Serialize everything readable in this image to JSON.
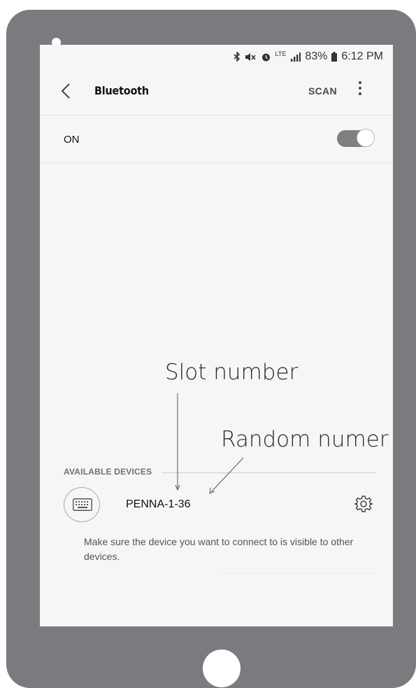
{
  "status_bar": {
    "battery": "83%",
    "time": "6:12 PM",
    "network": "LTE"
  },
  "header": {
    "title": "Bluetooth",
    "scan_label": "SCAN",
    "back_icon": "back-chevron-icon",
    "more_icon": "more-vertical-icon"
  },
  "switch_row": {
    "label": "ON",
    "state": "on"
  },
  "available": {
    "section_title": "AVAILABLE DEVICES",
    "devices": [
      {
        "name": "PENNA-1-36",
        "icon": "keyboard-icon",
        "action_icon": "gear-icon"
      }
    ],
    "help_text": "Make sure the device you want to connect to is visible to other devices."
  },
  "annotations": {
    "slot_label": "Slot number",
    "random_label": "Random numer"
  },
  "colors": {
    "tablet_frame": "#7b7b7f",
    "screen_bg": "#f6f6f6",
    "toggle_on": "#7f7f7f"
  }
}
